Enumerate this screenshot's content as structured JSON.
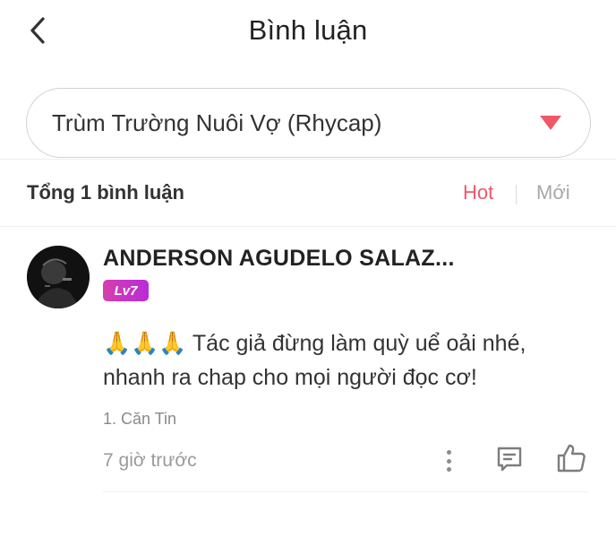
{
  "header": {
    "title": "Bình luận",
    "back_icon": "chevron-left-icon"
  },
  "chapter_select": {
    "value": "Trùm Trường Nuôi Vợ (Rhycap)",
    "caret_icon": "caret-down-icon",
    "caret_color": "#f0586a"
  },
  "summary": {
    "total_label": "Tổng 1 bình luận",
    "sort_hot": "Hot",
    "sort_new": "Mới",
    "active_color": "#f0586a"
  },
  "comment": {
    "username": "ANDERSON AGUDELO SALAZ...",
    "level": "Lv7",
    "emoji": "🙏🙏🙏",
    "text": "Tác giả đừng làm quỳ uể oải nhé, nhanh ra chap cho mọi người đọc cơ!",
    "chapter_tag": "1. Căn Tin",
    "time": "7 giờ trước",
    "actions": {
      "more_icon": "more-vertical-icon",
      "reply_icon": "comment-icon",
      "like_icon": "thumbs-up-icon"
    }
  }
}
